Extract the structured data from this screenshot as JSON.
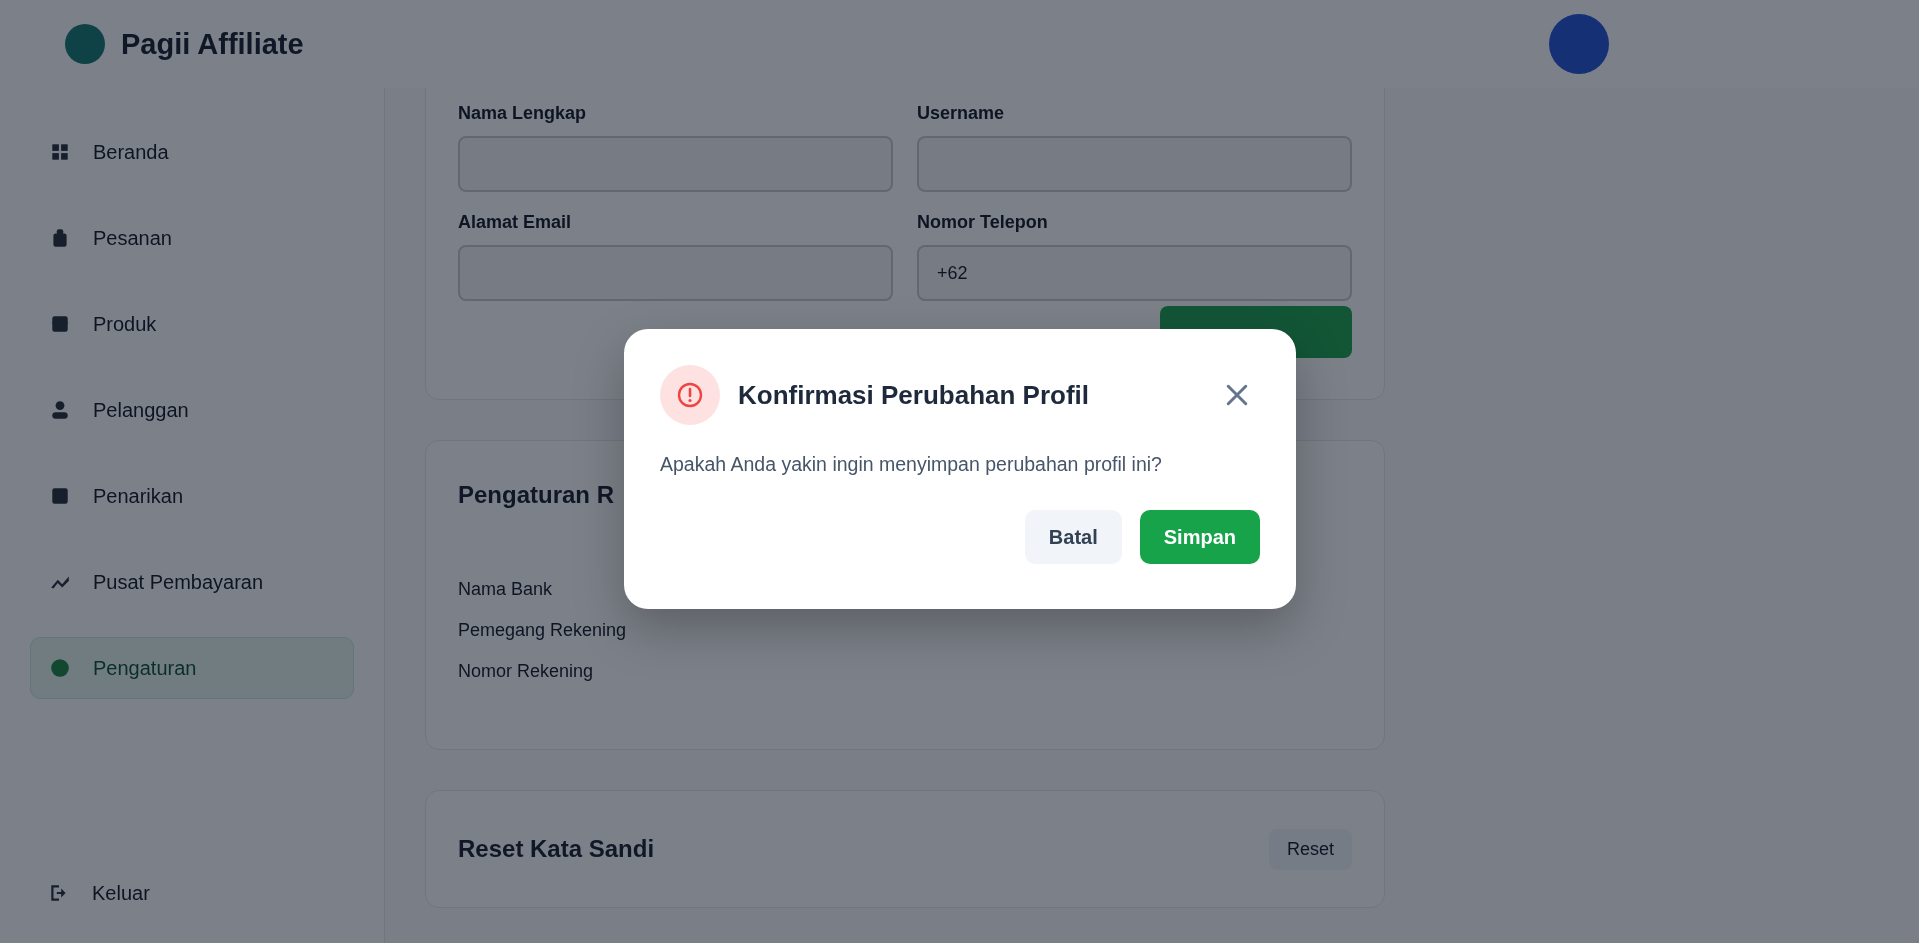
{
  "brand": {
    "name": "Pagii Affiliate"
  },
  "sidebar": {
    "items": [
      {
        "label": "Beranda",
        "selected": false
      },
      {
        "label": "Pesanan",
        "selected": false
      },
      {
        "label": "Produk",
        "selected": false
      },
      {
        "label": "Pelanggan",
        "selected": false
      },
      {
        "label": "Penarikan",
        "selected": false
      },
      {
        "label": "Pusat Pembayaran",
        "selected": false
      },
      {
        "label": "Pengaturan",
        "selected": true
      }
    ],
    "logout": "Keluar"
  },
  "profile_form": {
    "fields": [
      {
        "label": "Nama Lengkap"
      },
      {
        "label": "Username"
      },
      {
        "label": "Alamat Email"
      },
      {
        "label": "Nomor Telepon",
        "prefix": "+62"
      }
    ]
  },
  "bank_settings": {
    "title": "Pengaturan R",
    "rows": [
      "Nama Bank",
      "Pemegang Rekening",
      "Nomor Rekening"
    ]
  },
  "password_reset": {
    "title": "Reset Kata Sandi",
    "button": "Reset"
  },
  "dialog": {
    "title": "Konfirmasi Perubahan Profil",
    "message": "Apakah Anda yakin ingin menyimpan perubahan profil ini?",
    "buttons": [
      {
        "label": "Batal",
        "kind": "secondary"
      },
      {
        "label": "Simpan",
        "kind": "primary"
      }
    ]
  }
}
